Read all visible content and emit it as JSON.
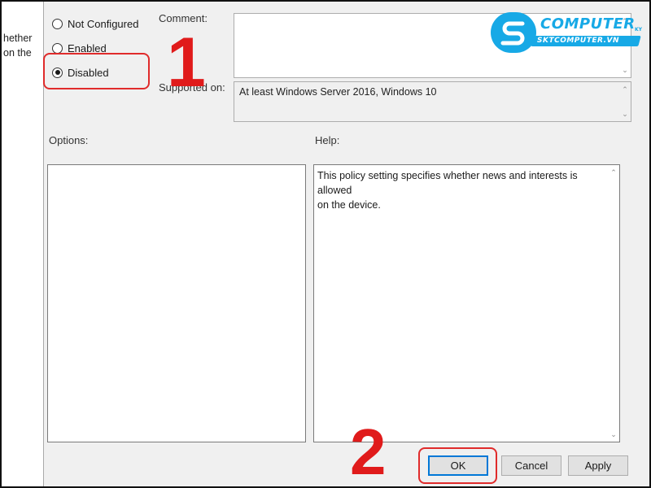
{
  "left_pane": {
    "lines": [
      "hether",
      "on the"
    ]
  },
  "state": {
    "options": [
      {
        "label": "Not Configured",
        "selected": false
      },
      {
        "label": "Enabled",
        "selected": false
      },
      {
        "label": "Disabled",
        "selected": true
      }
    ]
  },
  "comment": {
    "label": "Comment:",
    "value": ""
  },
  "supported": {
    "label": "Supported on:",
    "value": "At least Windows Server 2016, Windows 10"
  },
  "options_panel": {
    "label": "Options:"
  },
  "help_panel": {
    "label": "Help:",
    "text_line1": "This policy setting specifies whether news and interests is allowed",
    "text_line2": "on the device."
  },
  "buttons": {
    "ok": "OK",
    "cancel": "Cancel",
    "apply": "Apply"
  },
  "annotations": {
    "step1": "1",
    "step2": "2",
    "color": "#e01b1b"
  },
  "watermark": {
    "main": "COMPUTER",
    "sub": "KY",
    "url": "SKTCOMPUTER.VN",
    "color": "#17a9e6"
  },
  "icons": {
    "scroll_up": "chevron-up-icon",
    "scroll_down": "chevron-down-icon"
  }
}
